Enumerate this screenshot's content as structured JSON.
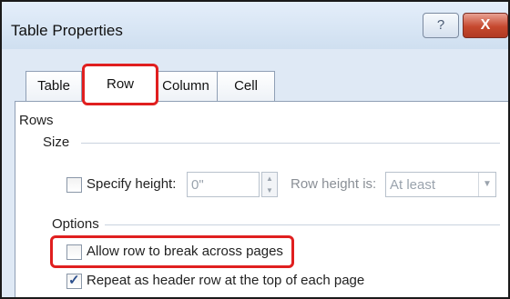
{
  "window": {
    "title": "Table Properties",
    "help_label": "?",
    "close_label": "X"
  },
  "tabs": [
    {
      "label": "Table"
    },
    {
      "label": "Row"
    },
    {
      "label": "Column"
    },
    {
      "label": "Cell"
    }
  ],
  "rows_section": {
    "heading": "Rows",
    "size_label": "Size",
    "specify_height_label": "Specify height:",
    "specify_height_checked": false,
    "height_value": "0\"",
    "row_height_is_label": "Row height is:",
    "row_height_mode": "At least",
    "options_label": "Options",
    "allow_break_label": "Allow row to break across pages",
    "allow_break_checked": false,
    "repeat_header_label": "Repeat as header row at the top of each page",
    "repeat_header_checked": true
  },
  "colors": {
    "highlight": "#e01f1f",
    "accent": "#2b4e8c"
  }
}
